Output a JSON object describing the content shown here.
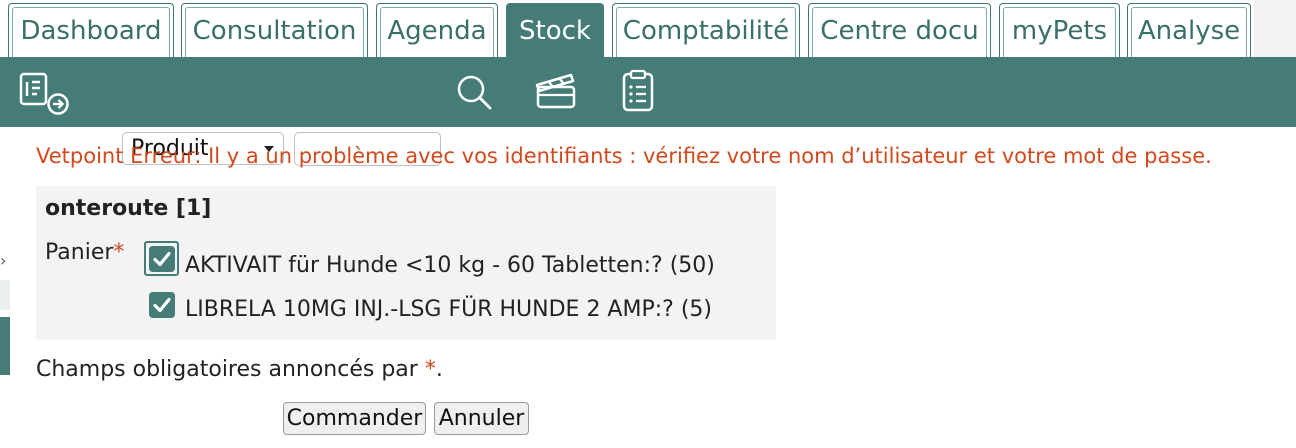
{
  "tabs": [
    {
      "label": "Dashboard",
      "active": false
    },
    {
      "label": "Consultation",
      "active": false
    },
    {
      "label": "Agenda",
      "active": false
    },
    {
      "label": "Stock",
      "active": true
    },
    {
      "label": "Comptabilité",
      "active": false
    },
    {
      "label": "Centre docu",
      "active": false
    },
    {
      "label": "myPets",
      "active": false
    },
    {
      "label": "Analyse",
      "active": false
    }
  ],
  "toolbar": {
    "icons": [
      "document-arrow-icon",
      "search-icon",
      "clapperboard-icon",
      "clipboard-list-icon"
    ],
    "select_value": "Produit",
    "search_value": ""
  },
  "error_message": "Vetpoint Erreur: Il y a un problème avec vos identifiants : vérifiez votre nom d’utilisateur et votre mot de passe.",
  "order": {
    "title": "onteroute [1]",
    "panier_label": "Panier",
    "required_mark": "*",
    "items": [
      {
        "label": "AKTIVAIT für Hunde <10 kg - 60 Tabletten:? (50)",
        "checked": true
      },
      {
        "label": "LIBRELA 10MG INJ.-LSG FÜR HUNDE 2 AMP:? (5)",
        "checked": true
      }
    ]
  },
  "required_legend": {
    "text": "Champs obligatoires annoncés par ",
    "mark": "*",
    "end": "."
  },
  "buttons": {
    "submit": "Commander",
    "cancel": "Annuler"
  },
  "colors": {
    "accent": "#467c77",
    "error": "#d2491c",
    "tab_text": "#3a6f6a"
  }
}
